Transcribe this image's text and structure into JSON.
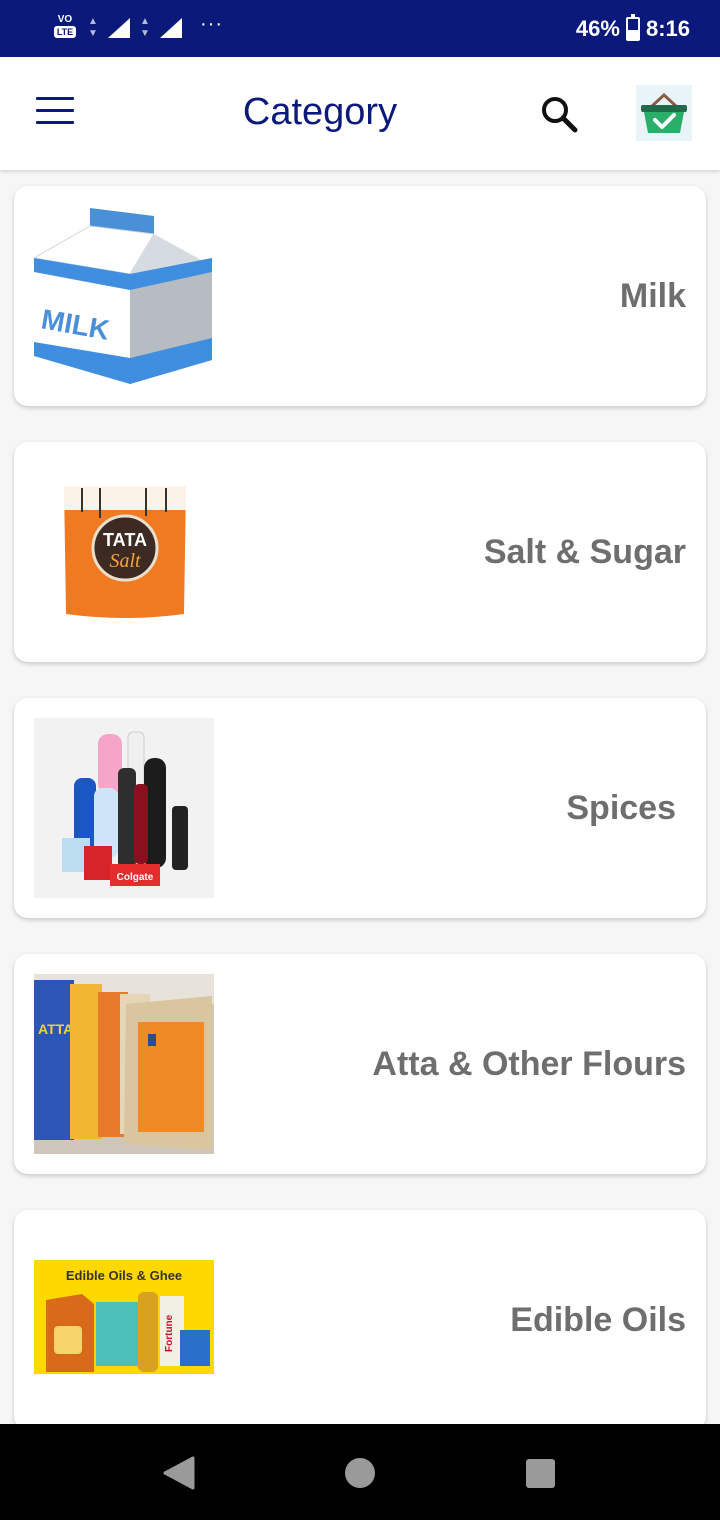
{
  "status_bar": {
    "carrier_top": "VO",
    "carrier_bottom": "LTE",
    "more_icon": "···",
    "battery_text": "46%",
    "battery_level": 0.46,
    "time": "8:16"
  },
  "app_bar": {
    "title": "Category",
    "menu_icon": "hamburger-menu-icon",
    "search_icon": "search-icon",
    "cart_icon": "shopping-basket-icon"
  },
  "categories": [
    {
      "label": "Milk",
      "image_text": "MILK"
    },
    {
      "label": "Salt & Sugar",
      "image_text_1": "TATA",
      "image_text_2": "Salt"
    },
    {
      "label": "Spices",
      "image_text": "Colgate"
    },
    {
      "label": "Atta & Other Flours",
      "image_text": "ATTA"
    },
    {
      "label": "Edible Oils",
      "image_text_1": "Edible Oils & Ghee",
      "image_text_2": "Fortune"
    }
  ],
  "colors": {
    "status_bar": "#0b1a7a",
    "title": "#0b1a7a",
    "card_text": "#6e6e6e",
    "background": "#f6f6f6"
  }
}
